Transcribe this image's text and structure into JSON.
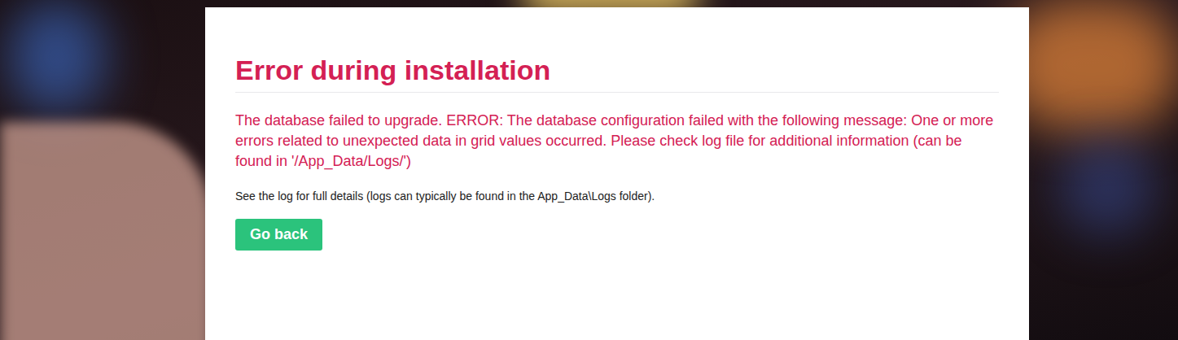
{
  "page": {
    "title": "Error during installation",
    "message": "The database failed to upgrade. ERROR: The database configuration failed with the following message: One or more errors related to unexpected data in grid values occurred. Please check log file for additional information (can be found in '/App_Data/Logs/')",
    "hint": "See the log for full details (logs can typically be found in the App_Data\\Logs folder).",
    "button": "Go back"
  }
}
